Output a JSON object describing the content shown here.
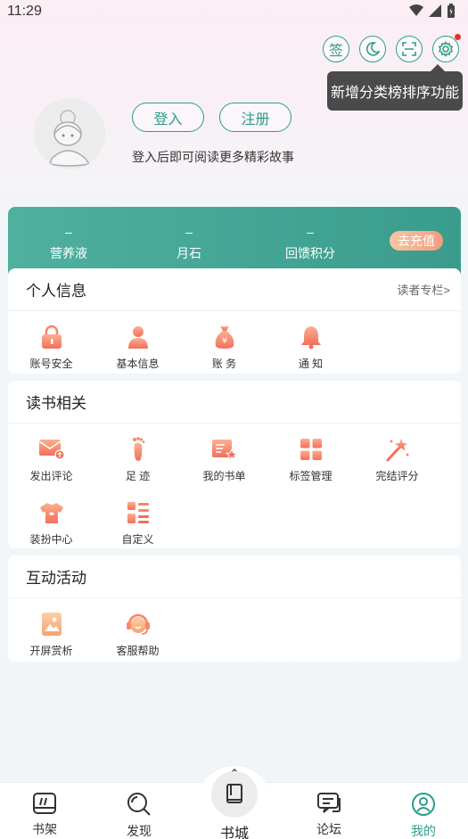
{
  "status_bar": {
    "time": "11:29"
  },
  "top_actions": {
    "sign_label": "签",
    "tooltip": "新增分类榜排序功能"
  },
  "profile": {
    "login_label": "登入",
    "register_label": "注册",
    "hint": "登入后即可阅读更多精彩故事"
  },
  "stats": {
    "items": [
      {
        "value": "–",
        "label": "营养液"
      },
      {
        "value": "–",
        "label": "月石"
      },
      {
        "value": "–",
        "label": "回馈积分"
      }
    ],
    "recharge_label": "去充值"
  },
  "personal": {
    "title": "个人信息",
    "link": "读者专栏>",
    "items": [
      {
        "label": "账号安全",
        "icon": "lock-icon"
      },
      {
        "label": "基本信息",
        "icon": "user-icon"
      },
      {
        "label": "账  务",
        "icon": "money-bag-icon"
      },
      {
        "label": "通  知",
        "icon": "bell-icon"
      }
    ]
  },
  "reading": {
    "title": "读书相关",
    "items": [
      {
        "label": "发出评论",
        "icon": "comment-mail-icon"
      },
      {
        "label": "足  迹",
        "icon": "footprint-icon"
      },
      {
        "label": "我的书单",
        "icon": "booklist-icon"
      },
      {
        "label": "标签管理",
        "icon": "tags-grid-icon"
      },
      {
        "label": "完结评分",
        "icon": "magic-wand-icon"
      },
      {
        "label": "装扮中心",
        "icon": "shirt-icon"
      },
      {
        "label": "自定义",
        "icon": "custom-list-icon"
      }
    ]
  },
  "activity": {
    "title": "互动活动",
    "items": [
      {
        "label": "开屏赏析",
        "icon": "picture-icon"
      },
      {
        "label": "客服帮助",
        "icon": "headset-icon"
      }
    ]
  },
  "bottom_nav": {
    "items": [
      {
        "label": "书架"
      },
      {
        "label": "发现"
      },
      {
        "label": "书城"
      },
      {
        "label": "论坛"
      },
      {
        "label": "我的"
      }
    ]
  },
  "colors": {
    "accent": "#2f9c8a",
    "icon_gradient": "#f7866a",
    "tooltip_bg": "#4a4a4a"
  }
}
